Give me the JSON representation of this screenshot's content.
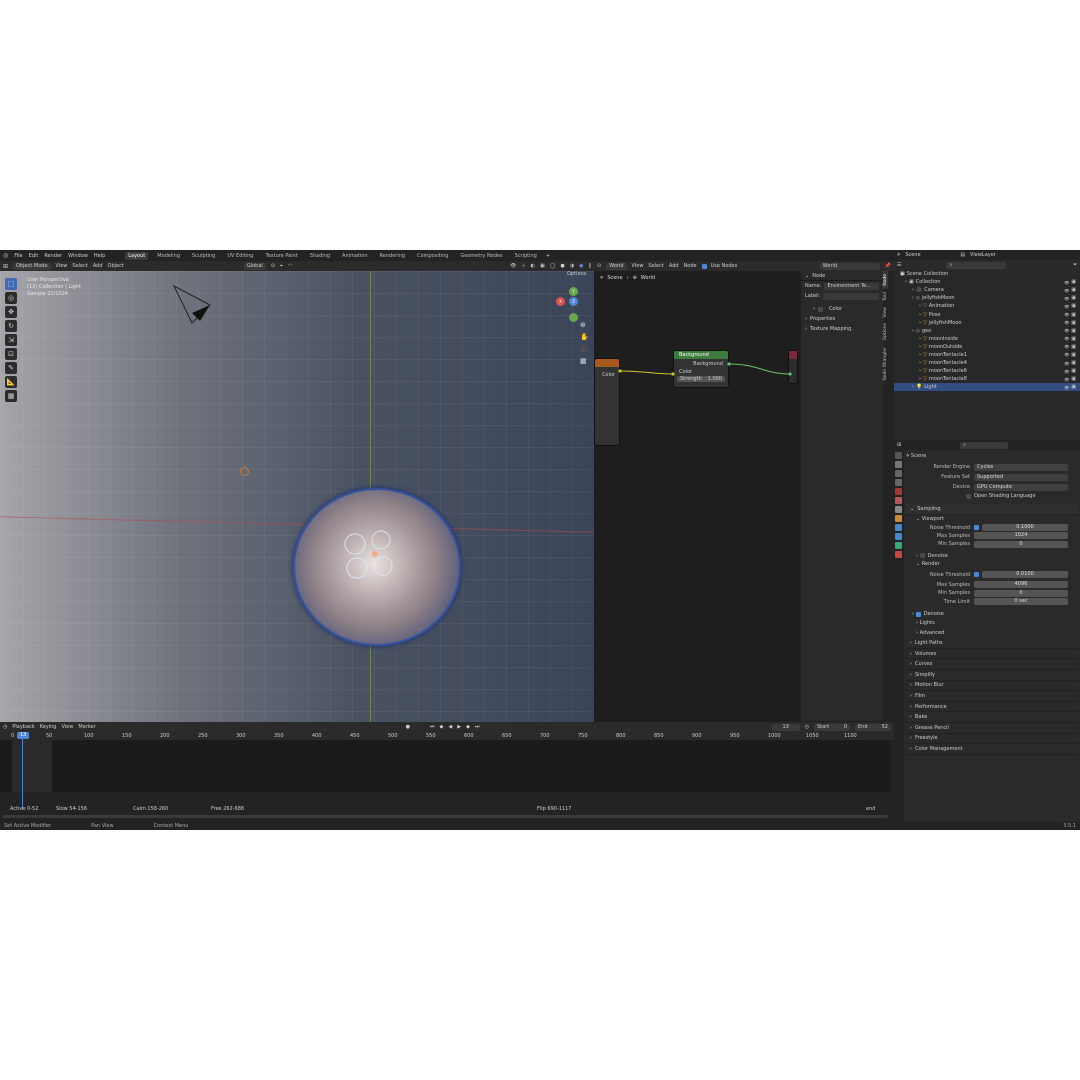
{
  "topbar": {
    "menus": [
      "File",
      "Edit",
      "Render",
      "Window",
      "Help"
    ],
    "workspaces": [
      "Layout",
      "Modeling",
      "Sculpting",
      "UV Editing",
      "Texture Paint",
      "Shading",
      "Animation",
      "Rendering",
      "Compositing",
      "Geometry Nodes",
      "Scripting"
    ],
    "active_workspace": "Layout",
    "add_tab": "+",
    "scene_label": "Scene",
    "viewlayer_label": "ViewLayer"
  },
  "viewport": {
    "mode": "Object Mode",
    "menus": [
      "View",
      "Select",
      "Add",
      "Object"
    ],
    "transform": "Global",
    "options": "Options",
    "info": [
      "User Perspective",
      "(13) Collection | Light",
      "Sample 22/1024"
    ]
  },
  "node_editor": {
    "type": "World",
    "menus": [
      "View",
      "Select",
      "Add",
      "Node"
    ],
    "use_nodes_label": "Use Nodes",
    "datablock": "World",
    "breadcrumb": [
      "Scene",
      "World"
    ],
    "left_node_socket": "Color",
    "background_node": {
      "title": "Background",
      "output": "Background",
      "input_color": "Color",
      "strength_label": "Strength",
      "strength_value": "1.000"
    }
  },
  "sidebar": {
    "section": "Node",
    "name_label": "Name:",
    "name_value": "Environment Te...",
    "label_label": "Label:",
    "color_panel": "Color",
    "properties_panel": "Properties",
    "texture_panel": "Texture Mapping",
    "tabs": [
      "Node",
      "Tool",
      "View",
      "Options",
      "Node Wrangler"
    ]
  },
  "outliner": {
    "root": "Scene Collection",
    "items": [
      {
        "label": "Collection",
        "depth": 1
      },
      {
        "label": "Camera",
        "depth": 2
      },
      {
        "label": "jellyfishMoon",
        "depth": 2
      },
      {
        "label": "Animation",
        "depth": 3
      },
      {
        "label": "Pose",
        "depth": 3
      },
      {
        "label": "jellyfishMoon",
        "depth": 3
      },
      {
        "label": "geo",
        "depth": 2
      },
      {
        "label": "moonInside",
        "depth": 3
      },
      {
        "label": "moonOutside",
        "depth": 3
      },
      {
        "label": "moonTentacle1",
        "depth": 3
      },
      {
        "label": "moonTentacle4",
        "depth": 3
      },
      {
        "label": "moonTentacle6",
        "depth": 3
      },
      {
        "label": "moonTentacle8",
        "depth": 3
      },
      {
        "label": "Light",
        "depth": 2
      }
    ]
  },
  "properties": {
    "scene": "Scene",
    "render_engine_label": "Render Engine",
    "render_engine": "Cycles",
    "feature_set_label": "Feature Set",
    "feature_set": "Supported",
    "device_label": "Device",
    "device": "GPU Compute",
    "osl_label": "Open Shading Language",
    "sampling": "Sampling",
    "viewport": "Viewport",
    "noise_threshold_label": "Noise Threshold",
    "vp_noise_threshold": "0.1000",
    "max_samples_label": "Max Samples",
    "vp_max_samples": "1024",
    "min_samples_label": "Min Samples",
    "vp_min_samples": "0",
    "denoise_label": "Denoise",
    "render": "Render",
    "r_noise_threshold": "0.0100",
    "r_max_samples": "4096",
    "r_min_samples": "0",
    "time_limit_label": "Time Limit",
    "r_time_limit": "0 sec",
    "lights": "Lights",
    "advanced": "Advanced",
    "panels": [
      "Light Paths",
      "Volumes",
      "Curves",
      "Simplify",
      "Motion Blur",
      "Film",
      "Performance",
      "Bake",
      "Grease Pencil",
      "Freestyle",
      "Color Management"
    ]
  },
  "timeline": {
    "menus": [
      "Playback",
      "Keying",
      "View",
      "Marker"
    ],
    "current_frame": "13",
    "start_label": "Start",
    "start": "0",
    "end_label": "End",
    "end": "52",
    "ticks": [
      "0",
      "50",
      "100",
      "150",
      "200",
      "250",
      "300",
      "350",
      "400",
      "450",
      "500",
      "550",
      "600",
      "650",
      "700",
      "750",
      "800",
      "850",
      "900",
      "950",
      "1000",
      "1050",
      "1100"
    ],
    "markers": [
      "Active 0-52",
      "Slow 54-156",
      "Calm 158-260",
      "Free 262-688",
      "Flip 690-1117",
      "end"
    ]
  },
  "statusbar": {
    "items": [
      "Set Active Modifier",
      "Pan View",
      "Context Menu"
    ],
    "version": "3.5.1"
  },
  "colors": {
    "accent": "#4f86d9",
    "selection": "#334d80",
    "bg_node_header": "#3d7a3d"
  }
}
